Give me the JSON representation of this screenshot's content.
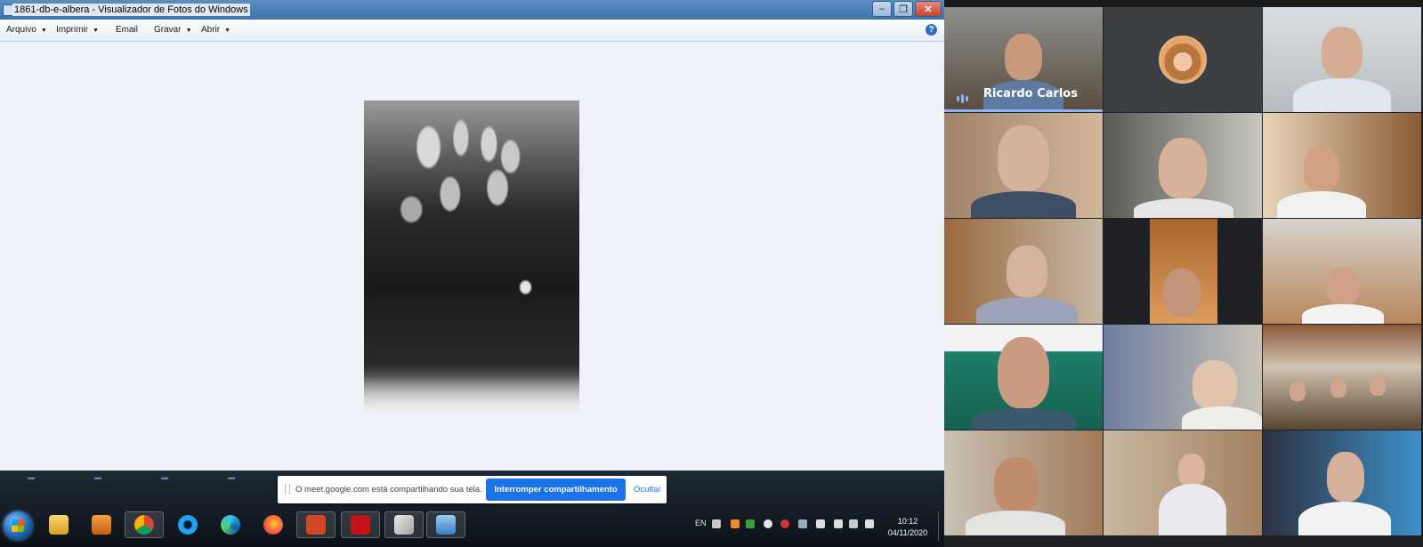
{
  "viewer": {
    "title": "1861-db-e-albera - Visualizador de Fotos do Windows",
    "menu": [
      {
        "label": "Arquivo",
        "has_dropdown": true
      },
      {
        "label": "Imprimir",
        "has_dropdown": true
      },
      {
        "label": "Email",
        "has_dropdown": false
      },
      {
        "label": "Gravar",
        "has_dropdown": true
      },
      {
        "label": "Abrir",
        "has_dropdown": true
      }
    ],
    "window_buttons": {
      "minimize": "–",
      "restore": "❐",
      "close": "✕"
    },
    "help": "?"
  },
  "share_bar": {
    "message": "O meet.google.com está compartilhando sua tela.",
    "stop_label": "Interromper compartilhamento",
    "hide_label": "Ocultar",
    "accent": "#1a73e8"
  },
  "taskbar": {
    "language": "EN",
    "time": "10:12",
    "date": "04/11/2020",
    "apps": [
      "folder-icon",
      "media-player-icon",
      "chrome-icon",
      "ie-icon",
      "edge-icon",
      "firefox-icon",
      "powerpoint-icon",
      "acrobat-icon",
      "paint-icon",
      "photo-viewer-icon"
    ]
  },
  "meet": {
    "active_speaker": "Ricardo Carlos",
    "accent": "#8ab4f8"
  }
}
